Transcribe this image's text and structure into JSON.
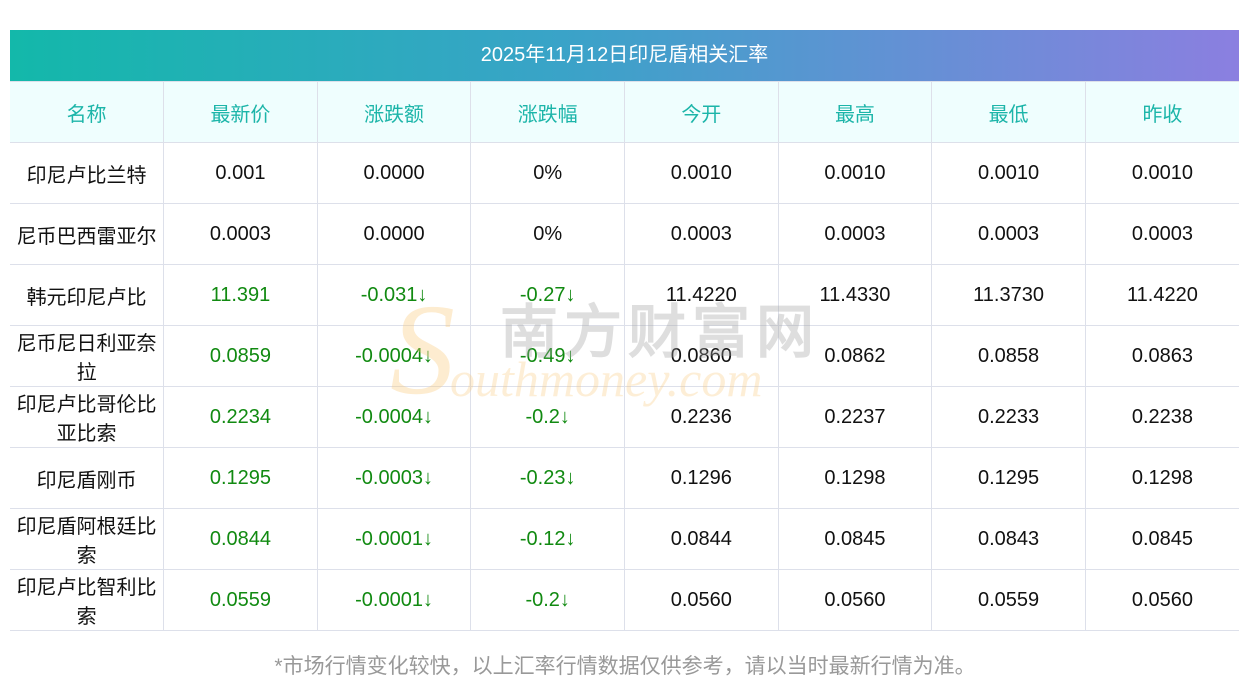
{
  "title": "2025年11月12日印尼盾相关汇率",
  "columns": [
    "名称",
    "最新价",
    "涨跌额",
    "涨跌幅",
    "今开",
    "最高",
    "最低",
    "昨收"
  ],
  "rows": [
    {
      "name": "印尼卢比兰特",
      "latest": "0.001",
      "change": "0.0000",
      "pct": "0%",
      "open": "0.0010",
      "high": "0.0010",
      "low": "0.0010",
      "prev": "0.0010",
      "down": false
    },
    {
      "name": "尼币巴西雷亚尔",
      "latest": "0.0003",
      "change": "0.0000",
      "pct": "0%",
      "open": "0.0003",
      "high": "0.0003",
      "low": "0.0003",
      "prev": "0.0003",
      "down": false
    },
    {
      "name": "韩元印尼卢比",
      "latest": "11.391",
      "change": "-0.031↓",
      "pct": "-0.27↓",
      "open": "11.4220",
      "high": "11.4330",
      "low": "11.3730",
      "prev": "11.4220",
      "down": true
    },
    {
      "name": "尼币尼日利亚奈拉",
      "latest": "0.0859",
      "change": "-0.0004↓",
      "pct": "-0.49↓",
      "open": "0.0860",
      "high": "0.0862",
      "low": "0.0858",
      "prev": "0.0863",
      "down": true
    },
    {
      "name": "印尼卢比哥伦比亚比索",
      "latest": "0.2234",
      "change": "-0.0004↓",
      "pct": "-0.2↓",
      "open": "0.2236",
      "high": "0.2237",
      "low": "0.2233",
      "prev": "0.2238",
      "down": true
    },
    {
      "name": "印尼盾刚币",
      "latest": "0.1295",
      "change": "-0.0003↓",
      "pct": "-0.23↓",
      "open": "0.1296",
      "high": "0.1298",
      "low": "0.1295",
      "prev": "0.1298",
      "down": true
    },
    {
      "name": "印尼盾阿根廷比索",
      "latest": "0.0844",
      "change": "-0.0001↓",
      "pct": "-0.12↓",
      "open": "0.0844",
      "high": "0.0845",
      "low": "0.0843",
      "prev": "0.0845",
      "down": true
    },
    {
      "name": "印尼卢比智利比索",
      "latest": "0.0559",
      "change": "-0.0001↓",
      "pct": "-0.2↓",
      "open": "0.0560",
      "high": "0.0560",
      "low": "0.0559",
      "prev": "0.0560",
      "down": true
    }
  ],
  "watermark": {
    "cn": "南方财富网",
    "en": "outhmoney.com",
    "s": "S"
  },
  "footer": "*市场行情变化较快，以上汇率行情数据仅供参考，请以当时最新行情为准。",
  "colors": {
    "down": "#118a11",
    "header_text": "#1cb5a9"
  }
}
